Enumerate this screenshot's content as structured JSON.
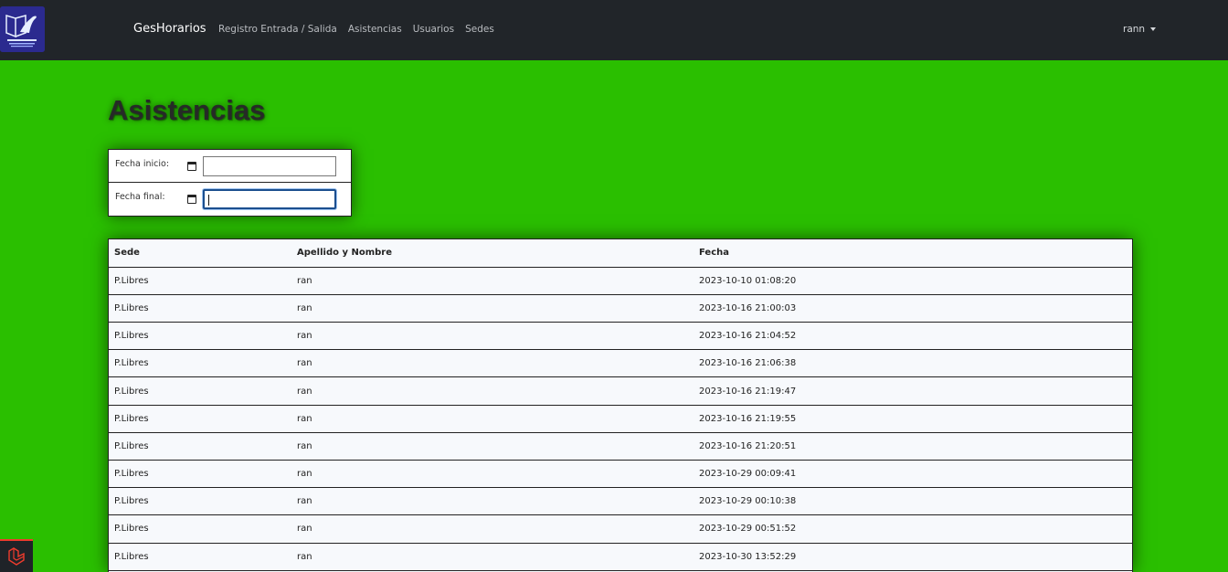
{
  "navbar": {
    "brand": "GesHorarios",
    "links": [
      "Registro Entrada / Salida",
      "Asistencias",
      "Usuarios",
      "Sedes"
    ],
    "user": "rann"
  },
  "page": {
    "title": "Asistencias"
  },
  "filters": {
    "start_label": "Fecha inicio:",
    "end_label": "Fecha final:",
    "start_value": "",
    "end_value": ""
  },
  "table": {
    "headers": [
      "Sede",
      "Apellido y Nombre",
      "Fecha"
    ],
    "rows": [
      [
        "P.Libres",
        "ran",
        "2023-10-10 01:08:20"
      ],
      [
        "P.Libres",
        "ran",
        "2023-10-16 21:00:03"
      ],
      [
        "P.Libres",
        "ran",
        "2023-10-16 21:04:52"
      ],
      [
        "P.Libres",
        "ran",
        "2023-10-16 21:06:38"
      ],
      [
        "P.Libres",
        "ran",
        "2023-10-16 21:19:47"
      ],
      [
        "P.Libres",
        "ran",
        "2023-10-16 21:19:55"
      ],
      [
        "P.Libres",
        "ran",
        "2023-10-16 21:20:51"
      ],
      [
        "P.Libres",
        "ran",
        "2023-10-29 00:09:41"
      ],
      [
        "P.Libres",
        "ran",
        "2023-10-29 00:10:38"
      ],
      [
        "P.Libres",
        "ran",
        "2023-10-29 00:51:52"
      ],
      [
        "P.Libres",
        "ran",
        "2023-10-30 13:52:29"
      ]
    ]
  },
  "colors": {
    "background": "#2abf00",
    "navbar": "#212529",
    "logo": "#2b2a8f",
    "laravel_accent": "#ef3b2d"
  },
  "icons": {
    "logo": "institution-logo-icon",
    "calendar": "calendar-icon",
    "user_caret": "caret-down-icon",
    "laravel": "laravel-icon"
  }
}
